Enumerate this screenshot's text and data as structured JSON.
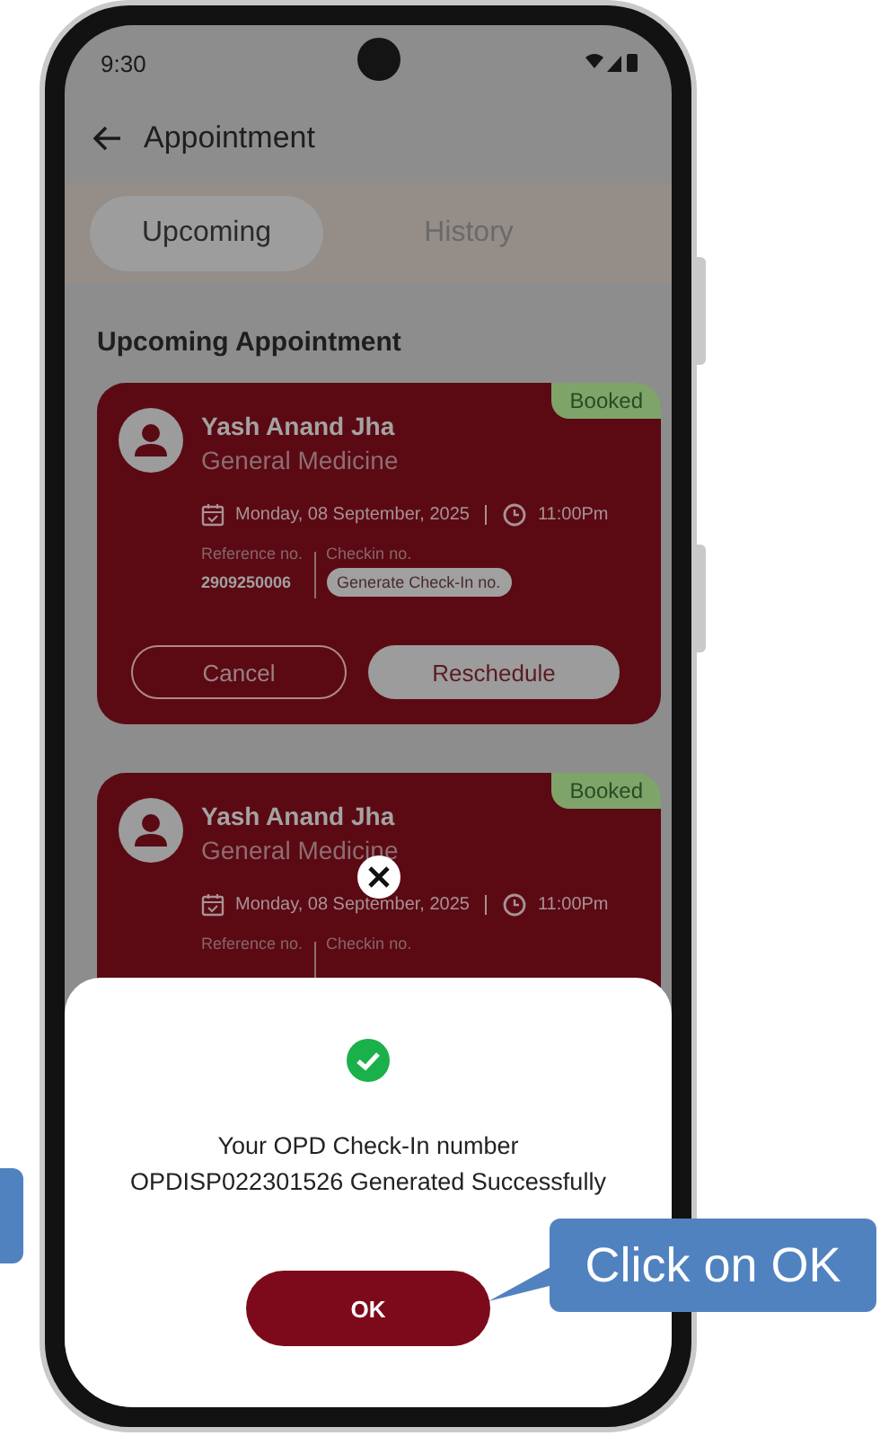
{
  "status_bar": {
    "time": "9:30"
  },
  "header": {
    "title": "Appointment"
  },
  "tabs": [
    {
      "label": "Upcoming",
      "selected": true
    },
    {
      "label": "History",
      "selected": false
    }
  ],
  "section_title": "Upcoming Appointment",
  "appointments": [
    {
      "status": "Booked",
      "name": "Yash Anand Jha",
      "department": "General Medicine",
      "date": "Monday, 08 September, 2025",
      "time": "11:00Pm",
      "reference_label": "Reference no.",
      "reference": "2909250006",
      "checkin_label": "Checkin no.",
      "checkin_action": "Generate Check-In no.",
      "actions": [
        "Cancel",
        "Reschedule"
      ]
    },
    {
      "status": "Booked",
      "name": "Yash Anand Jha",
      "department": "General Medicine",
      "date": "Monday, 08 September, 2025",
      "time": "11:00Pm",
      "reference_label": "Reference no.",
      "checkin_label": "Checkin no."
    }
  ],
  "dialog": {
    "message_lines": [
      "Your OPD Check-In number",
      "OPDISP022301526 Generated Successfully"
    ],
    "button": "OK"
  },
  "callout": {
    "text": "Click on OK"
  }
}
